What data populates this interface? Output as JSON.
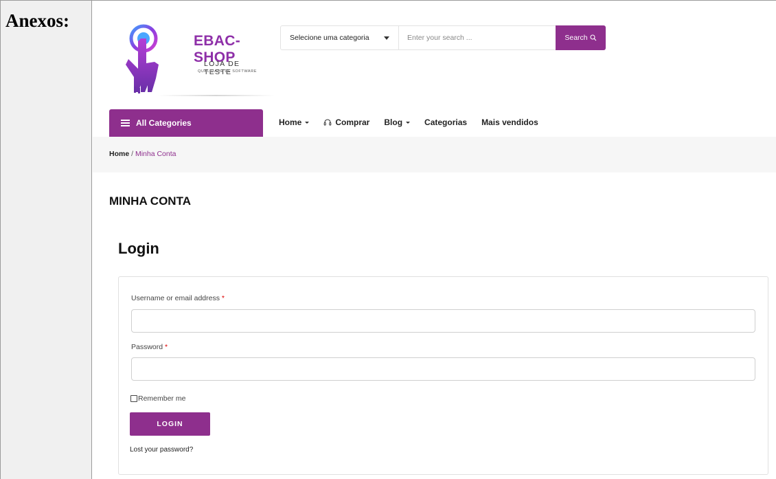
{
  "doc": {
    "label": "Anexos:"
  },
  "header": {
    "logo_title": "EBAC-SHOP",
    "logo_subtitle": "LOJA DE TESTE",
    "logo_tagline": "QUALIDADE DE SOFTWARE"
  },
  "search": {
    "category_label": "Selecione uma categoria",
    "placeholder": "Enter your search ...",
    "button_label": "Search"
  },
  "nav": {
    "all_categories": "All Categories",
    "items": [
      "Home",
      "Comprar",
      "Blog",
      "Categorias",
      "Mais vendidos"
    ]
  },
  "breadcrumb": {
    "home": "Home",
    "separator": "/",
    "current": "Minha Conta"
  },
  "page": {
    "title": "MINHA CONTA",
    "section_title": "Login"
  },
  "form": {
    "username_label": "Username or email address",
    "password_label": "Password",
    "required_mark": "*",
    "remember_label": "Remember me",
    "login_button": "LOGIN",
    "lost_password": "Lost your password?"
  },
  "colors": {
    "brand": "#8e2f8d",
    "logo_text": "#8e2fa8",
    "required": "#dd0000"
  }
}
